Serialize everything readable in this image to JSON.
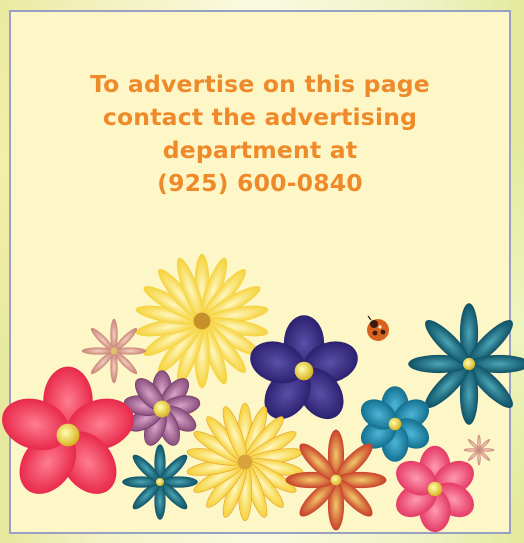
{
  "ad": {
    "lines": [
      "To advertise on this page",
      "contact the advertising",
      "department at",
      "(925) 600-0840"
    ]
  },
  "colors": {
    "text": "#ef8a2a",
    "card_background": "#fdf6c7",
    "card_border": "#9aa0c4"
  },
  "decorations": [
    "yellow-daisy-icon",
    "pink-star-flower-icon",
    "ladybug-icon",
    "purple-flower-icon",
    "mauve-flower-icon",
    "teal-star-flower-icon",
    "red-flower-icon",
    "blue-flower-icon",
    "small-teal-flower-icon",
    "orange-daisy-icon",
    "red-star-flower-icon",
    "pink-flower-icon",
    "tiny-star-icon"
  ]
}
